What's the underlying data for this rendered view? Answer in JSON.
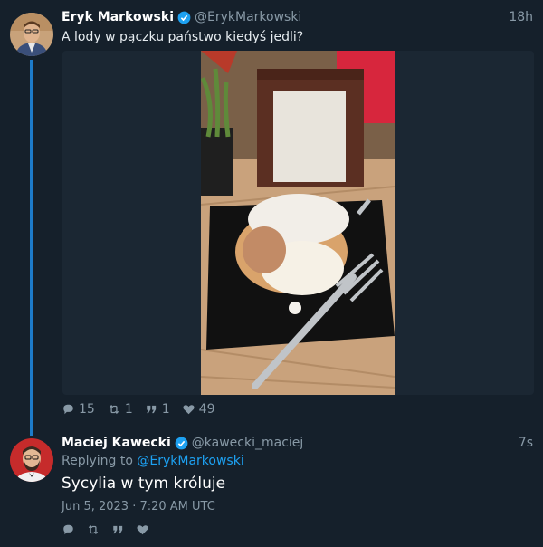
{
  "tweet1": {
    "name": "Eryk Markowski",
    "handle": "@ErykMarkowski",
    "time": "18h",
    "text": "A lody w pączku państwo kiedyś jedli?",
    "stats": {
      "replies": "15",
      "retweets": "1",
      "quotes": "1",
      "likes": "49"
    }
  },
  "tweet2": {
    "name": "Maciej Kawecki",
    "handle": "@kawecki_maciej",
    "time": "7s",
    "replying_prefix": "Replying to ",
    "replying_handle": "@ErykMarkowski",
    "text": "Sycylia w tym króluje",
    "date": "Jun 5, 2023 · 7:20 AM UTC"
  },
  "icons": [
    "verified-icon",
    "reply-icon",
    "retweet-icon",
    "quote-icon",
    "like-icon"
  ],
  "colors": {
    "background": "#15202b",
    "accent": "#1da1f2",
    "secondary_text": "#8899a6",
    "thread_line": "#1d7bc9"
  }
}
